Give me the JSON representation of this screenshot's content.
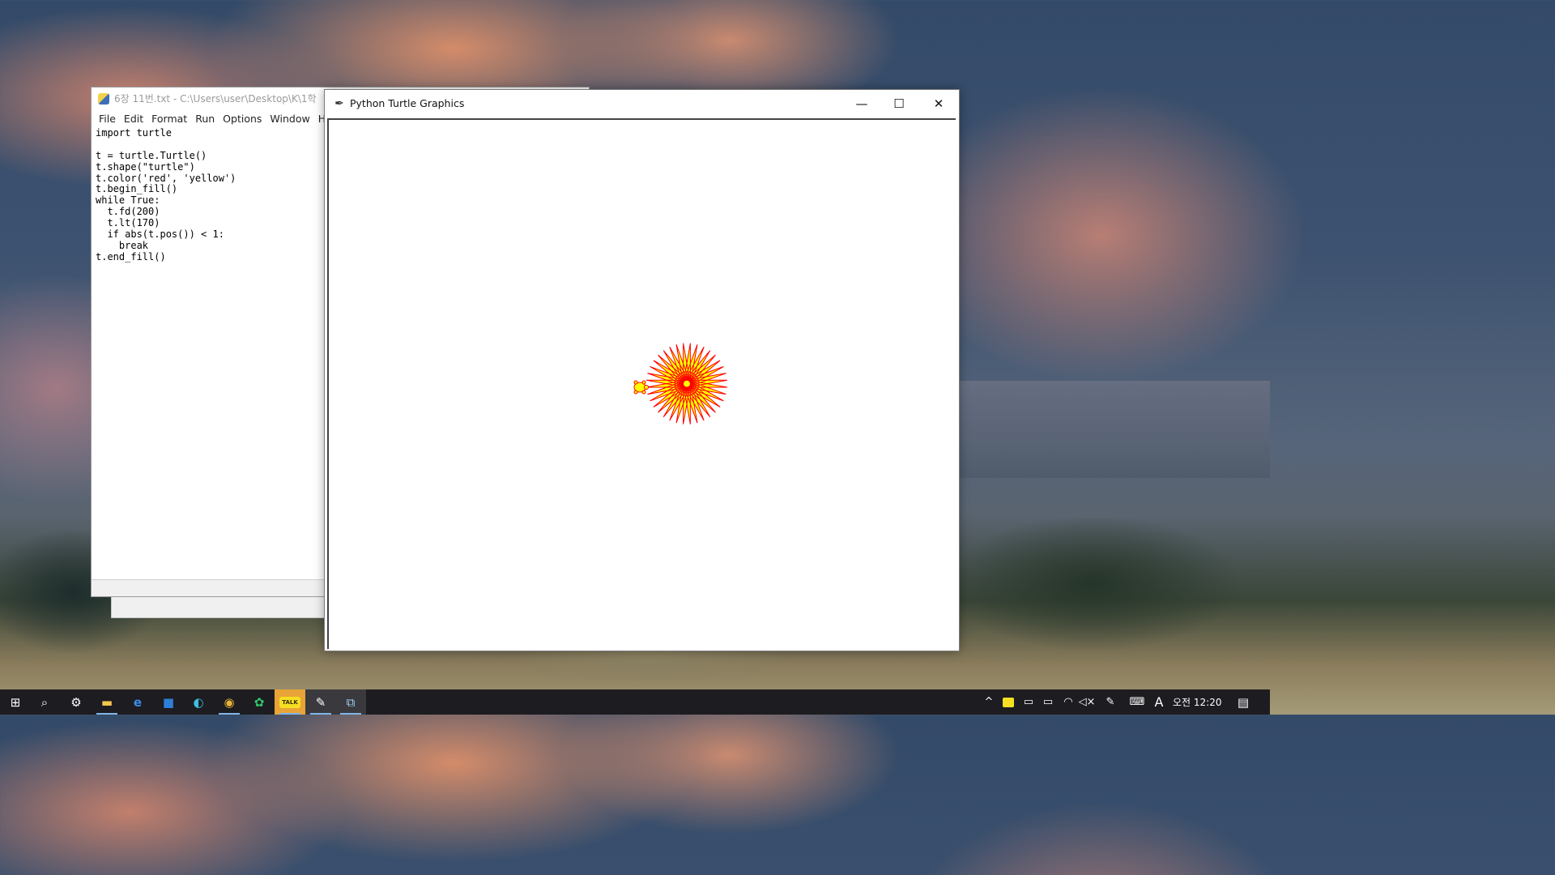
{
  "desktop": {
    "wallpaper": "impressionist sky painting"
  },
  "idle": {
    "title": "6장 11번.txt - C:\\Users\\user\\Desktop\\K\\1학",
    "menu": [
      "File",
      "Edit",
      "Format",
      "Run",
      "Options",
      "Window",
      "Help"
    ],
    "code": [
      "import turtle",
      "",
      "t = turtle.Turtle()",
      "t.shape(\"turtle\")",
      "t.color('red', 'yellow')",
      "t.begin_fill()",
      "while True:",
      "  t.fd(200)",
      "  t.lt(170)",
      "  if abs(t.pos()) < 1:",
      "    break",
      "t.end_fill()"
    ]
  },
  "turtle_window": {
    "title": "Python Turtle Graphics",
    "buttons": {
      "minimize": "—",
      "maximize": "☐",
      "close": "✕"
    },
    "drawing": {
      "pen_color": "#ff0000",
      "fill_color": "#ffff00",
      "step": 200,
      "turn_degrees": 170,
      "turtle_shape": "turtle"
    }
  },
  "taskbar": {
    "items": [
      {
        "icon": "windows-start-icon",
        "glyph": "⊞"
      },
      {
        "icon": "search-icon",
        "glyph": "⌕"
      },
      {
        "icon": "settings-gear-icon",
        "glyph": "⚙"
      },
      {
        "icon": "file-explorer-icon",
        "glyph": "▬"
      },
      {
        "icon": "internet-explorer-icon",
        "glyph": "e"
      },
      {
        "icon": "store-icon",
        "glyph": "■"
      },
      {
        "icon": "edge-icon",
        "glyph": "◐"
      },
      {
        "icon": "chrome-icon",
        "glyph": "◉"
      },
      {
        "icon": "green-app-icon",
        "glyph": "✿"
      },
      {
        "icon": "kakaotalk-icon",
        "glyph": "TALK"
      },
      {
        "icon": "idle-editor-icon",
        "glyph": "✎"
      },
      {
        "icon": "python-turtle-icon",
        "glyph": "⧉"
      }
    ],
    "tray": {
      "ime_indicator": "A",
      "time": "오전 12:20"
    }
  }
}
